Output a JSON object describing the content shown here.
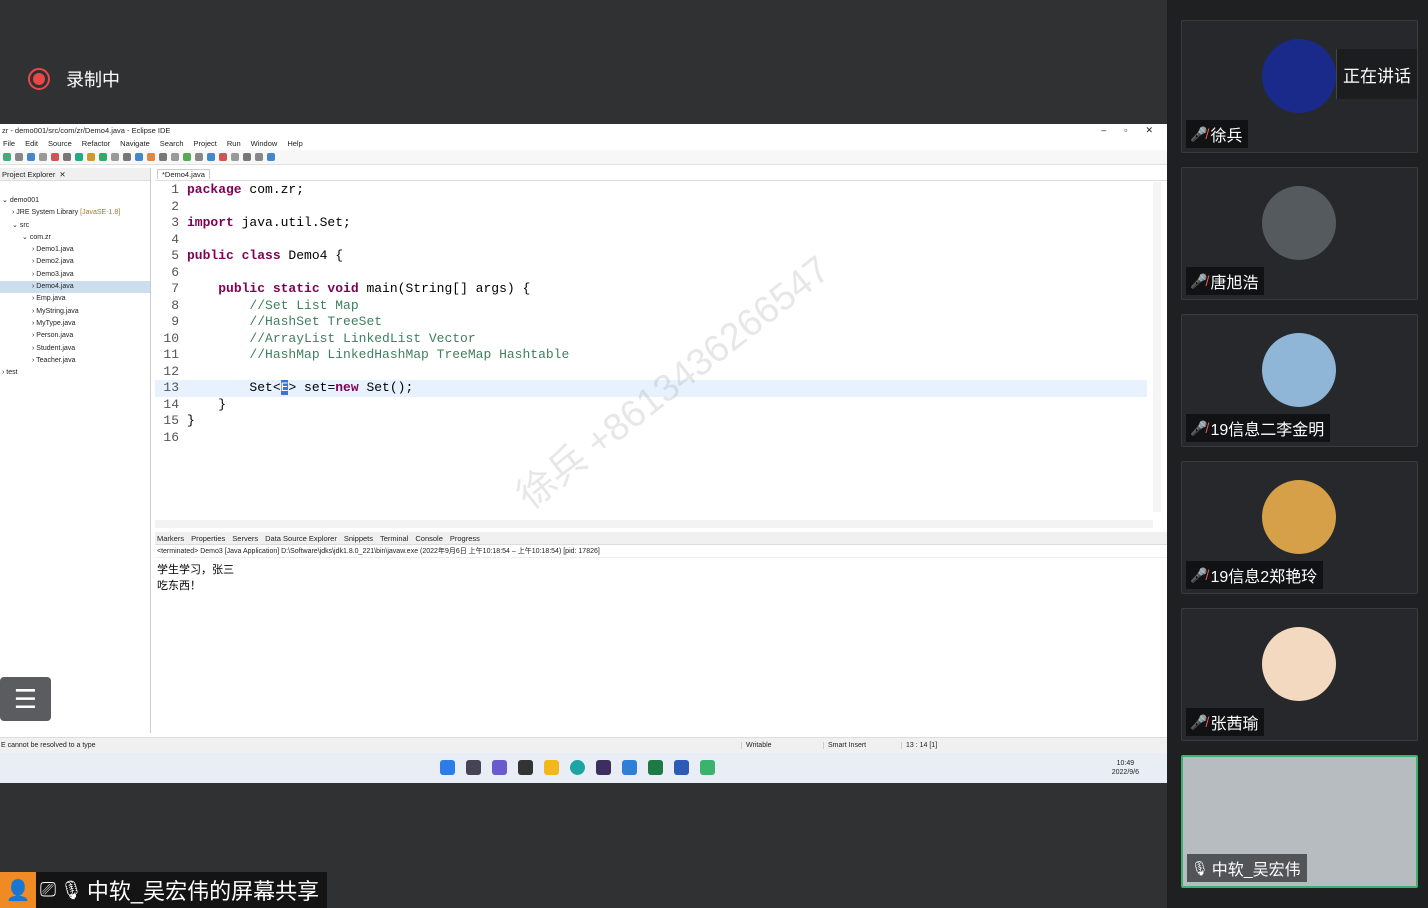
{
  "meeting": {
    "recording_label": "录制中",
    "share_label": "中软_吴宏伟的屏幕共享"
  },
  "eclipse": {
    "window_title": "zr - demo001/src/com/zr/Demo4.java - Eclipse IDE",
    "menu": [
      "File",
      "Edit",
      "Source",
      "Refactor",
      "Navigate",
      "Search",
      "Project",
      "Run",
      "Window",
      "Help"
    ],
    "explorer_tab": "Project Explorer",
    "tree": [
      {
        "label": "demo001",
        "indent": 0,
        "arrow": "⌄"
      },
      {
        "label": "JRE System Library",
        "note": "[JavaSE-1.8]",
        "indent": 1,
        "arrow": "›"
      },
      {
        "label": "src",
        "indent": 1,
        "arrow": "⌄"
      },
      {
        "label": "com.zr",
        "indent": 2,
        "arrow": "⌄"
      },
      {
        "label": "Demo1.java",
        "indent": 3,
        "arrow": "›"
      },
      {
        "label": "Demo2.java",
        "indent": 3,
        "arrow": "›"
      },
      {
        "label": "Demo3.java",
        "indent": 3,
        "arrow": "›"
      },
      {
        "label": "Demo4.java",
        "indent": 3,
        "arrow": "›",
        "selected": true
      },
      {
        "label": "Emp.java",
        "indent": 3,
        "arrow": "›"
      },
      {
        "label": "MyString.java",
        "indent": 3,
        "arrow": "›"
      },
      {
        "label": "MyType.java",
        "indent": 3,
        "arrow": "›"
      },
      {
        "label": "Person.java",
        "indent": 3,
        "arrow": "›"
      },
      {
        "label": "Student.java",
        "indent": 3,
        "arrow": "›"
      },
      {
        "label": "Teacher.java",
        "indent": 3,
        "arrow": "›"
      },
      {
        "label": "test",
        "indent": 0,
        "arrow": "›"
      }
    ],
    "editor_tab": "*Demo4.java",
    "code_lines": [
      {
        "n": "1",
        "html": "<span class='kw'>package</span> com.zr;"
      },
      {
        "n": "2",
        "html": ""
      },
      {
        "n": "3",
        "html": "<span class='kw'>import</span> java.util.Set;"
      },
      {
        "n": "4",
        "html": ""
      },
      {
        "n": "5",
        "html": "<span class='kw'>public class</span> Demo4 {"
      },
      {
        "n": "6",
        "html": ""
      },
      {
        "n": "7",
        "html": "    <span class='kw'>public static void</span> main(String[] args) {"
      },
      {
        "n": "8",
        "html": "        <span class='cm'>//Set List Map</span>"
      },
      {
        "n": "9",
        "html": "        <span class='cm'>//HashSet TreeSet</span>"
      },
      {
        "n": "10",
        "html": "        <span class='cm'>//ArrayList LinkedList Vector</span>"
      },
      {
        "n": "11",
        "html": "        <span class='cm'>//HashMap LinkedHashMap TreeMap Hashtable</span>"
      },
      {
        "n": "12",
        "html": ""
      },
      {
        "n": "13",
        "html": "        Set&lt;<span style='background:#3875d7;color:#fff'>E</span>&gt; set=<span class='kw'>new</span> Set();",
        "current": true
      },
      {
        "n": "14",
        "html": "    }"
      },
      {
        "n": "15",
        "html": "}"
      },
      {
        "n": "16",
        "html": ""
      }
    ],
    "console_tabs": [
      "Markers",
      "Properties",
      "Servers",
      "Data Source Explorer",
      "Snippets",
      "Terminal",
      "Console",
      "Progress"
    ],
    "console_header": "<terminated> Demo3 [Java Application] D:\\Software\\jdks\\jdk1.8.0_221\\bin\\javaw.exe  (2022年9月6日 上午10:18:54 – 上午10:18:54) [pid: 17826]",
    "console_output": [
      "学生学习，张三",
      "吃东西！"
    ],
    "status_error": "E cannot be resolved to a type",
    "status_writable": "Writable",
    "status_insert": "Smart Insert",
    "status_pos": "13 : 14 [1]",
    "clock_time": "10:49",
    "clock_date": "2022/9/6"
  },
  "watermark": "徐兵 +8613436266547",
  "participants": [
    {
      "name": "徐兵",
      "speaking_label": "正在讲话",
      "avatar_color": "#1a2a8a",
      "muted": true
    },
    {
      "name": "唐旭浩",
      "avatar_color": "#555a5e",
      "muted": true
    },
    {
      "name": "19信息二李金明",
      "avatar_color": "#8fb6d6",
      "muted": true
    },
    {
      "name": "19信息2郑艳玲",
      "avatar_color": "#d6a048",
      "muted": true
    },
    {
      "name": "张茜瑜",
      "avatar_color": "#f3d9c0",
      "muted": true
    },
    {
      "name": "中软_吴宏伟",
      "avatar_color": "#b7bcc0",
      "muted": false
    }
  ]
}
